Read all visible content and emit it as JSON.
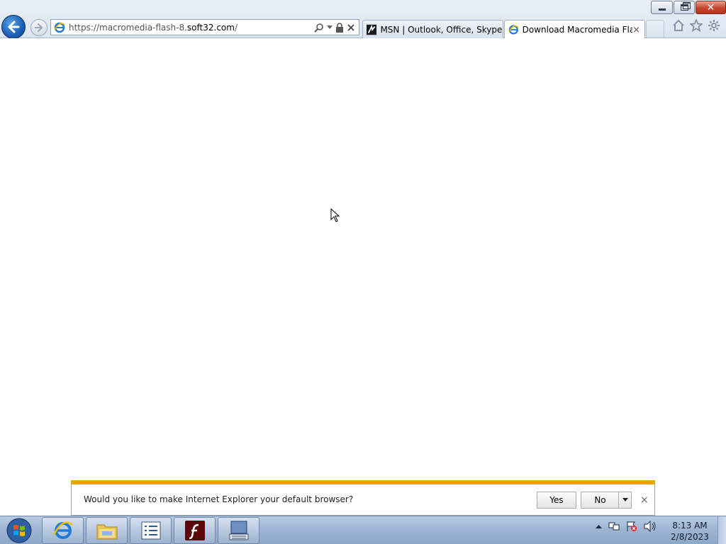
{
  "browser": {
    "address": {
      "url_prefix": "https://macromedia-flash-8.",
      "url_domain": "soft32.com",
      "url_suffix": "/"
    },
    "tabs": [
      {
        "label": "MSN | Outlook, Office, Skype, ...",
        "active": false,
        "icon": "msn-icon"
      },
      {
        "label": "Download Macromedia Fla...",
        "active": true,
        "icon": "ie-icon",
        "close": "×"
      }
    ]
  },
  "notification": {
    "message": "Would you like to make Internet Explorer your default browser?",
    "yes_label": "Yes",
    "no_label": "No",
    "close": "×",
    "accent_color": "#e9a400"
  },
  "taskbar": {
    "apps": [
      "internet-explorer",
      "windows-explorer",
      "task-list",
      "flash",
      "on-screen-keyboard"
    ],
    "clock": {
      "time": "8:13 AM",
      "date": "2/8/2023"
    }
  }
}
